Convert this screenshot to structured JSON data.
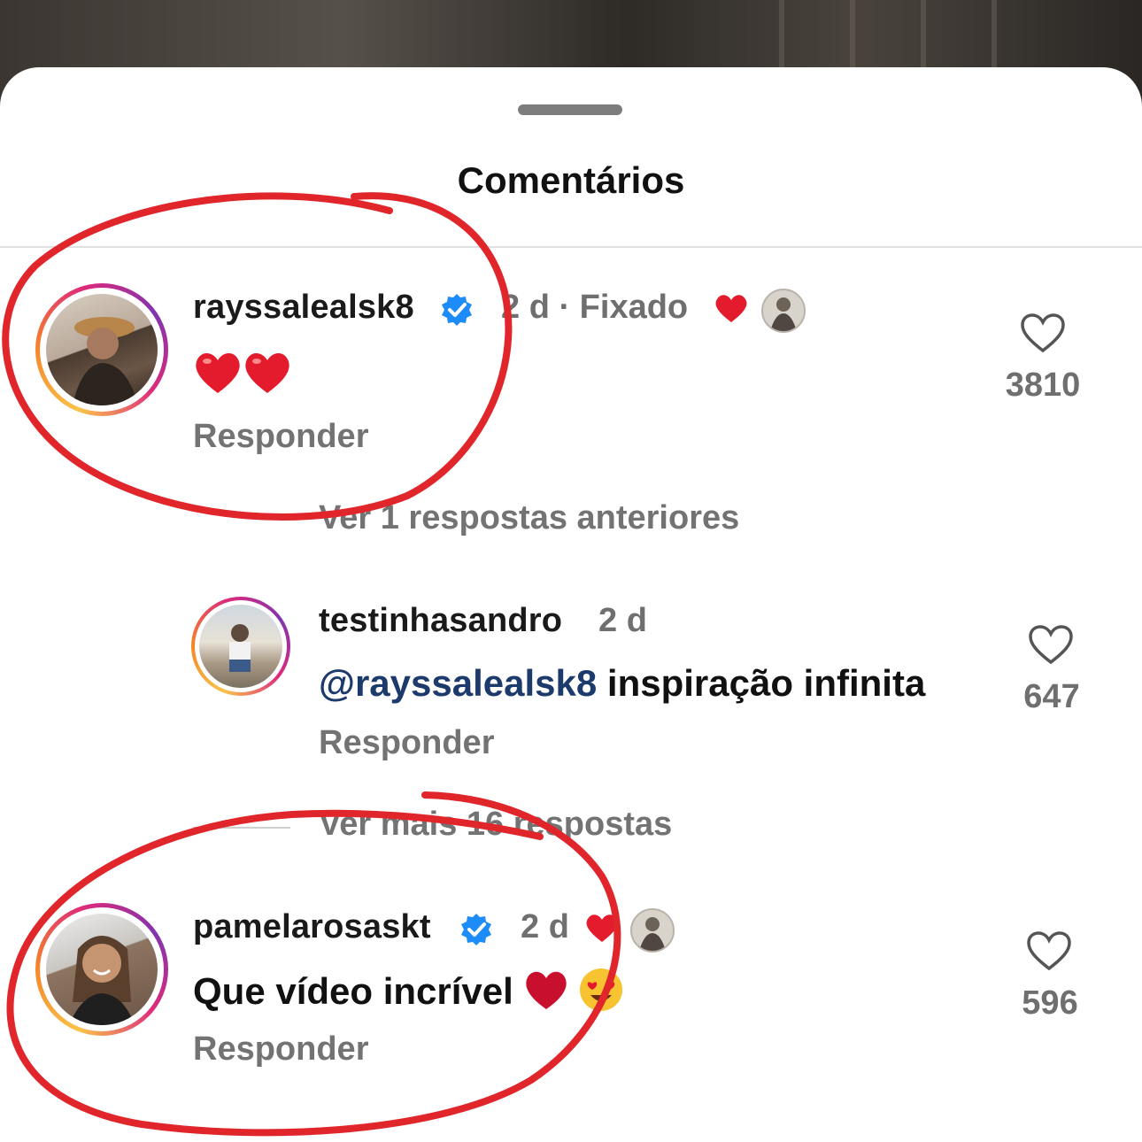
{
  "sheet": {
    "title": "Comentários"
  },
  "comments": [
    {
      "username": "rayssalealsk8",
      "verified": true,
      "meta": "2 d · Fixado",
      "text": "❤️❤️",
      "reply_label": "Responder",
      "likes": "3810"
    },
    {
      "username": "testinhasandro",
      "verified": false,
      "meta": "2 d",
      "mention": "@rayssalealsk8",
      "text": " inspiração infinita",
      "reply_label": "Responder",
      "likes": "647"
    },
    {
      "username": "pamelarosaskt",
      "verified": true,
      "meta": "2 d",
      "text": "Que vídeo incrível",
      "reply_label": "Responder",
      "likes": "596"
    }
  ],
  "replies_links": {
    "previous": "Ver 1 respostas anteriores",
    "more": "Ver mais 16 respostas"
  },
  "colors": {
    "annotation": "#e0262b",
    "verified": "#1d8cf8",
    "heart": "#e41b2c",
    "mention": "#1c3a6b"
  },
  "icons": [
    "verified-badge-icon",
    "heart-outline-icon",
    "heart-emoji-icon",
    "heart-eyes-emoji-icon"
  ]
}
